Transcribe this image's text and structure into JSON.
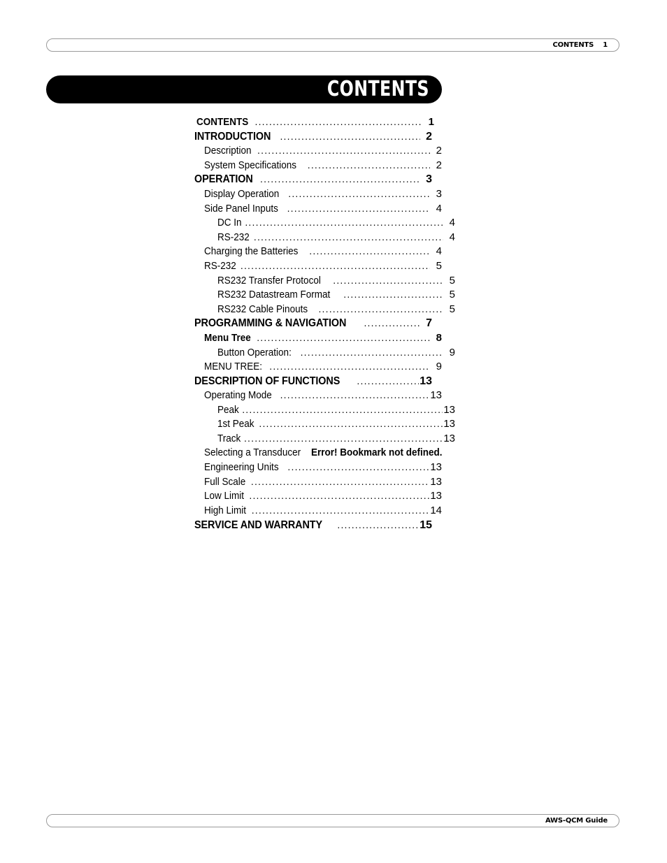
{
  "document": {
    "running_header": "CONTENTS    1",
    "running_footer": "AWS-QCM Guide",
    "title_bar": "CONTENTS"
  },
  "toc": {
    "entries": [
      {
        "title": "CONTENTS",
        "page": "1",
        "level": 1,
        "bold": true,
        "leader": true,
        "extra_indent": true
      },
      {
        "title": "INTRODUCTION",
        "page": "2",
        "level": 1,
        "bold": true,
        "leader": true
      },
      {
        "title": "Description",
        "page": "2",
        "level": 2,
        "bold": false,
        "leader": true
      },
      {
        "title": "System Specifications",
        "page": "2",
        "level": 2,
        "bold": false,
        "leader": true
      },
      {
        "title": "OPERATION",
        "page": "3",
        "level": 1,
        "bold": true,
        "leader": true
      },
      {
        "title": "Display Operation",
        "page": "3",
        "level": 2,
        "bold": false,
        "leader": true
      },
      {
        "title": "Side   Panel Inputs",
        "page": "4",
        "level": 2,
        "bold": false,
        "leader": true
      },
      {
        "title": "DC In",
        "page": "4",
        "level": 3,
        "bold": false,
        "leader": true
      },
      {
        "title": "RS-232",
        "page": "4",
        "level": 3,
        "bold": false,
        "leader": true
      },
      {
        "title": "Charging the Batteries",
        "page": "4",
        "level": 2,
        "bold": false,
        "leader": true
      },
      {
        "title": "RS-232",
        "page": "5",
        "level": 2,
        "bold": false,
        "leader": true
      },
      {
        "title": "RS232 Transfer Protocol",
        "page": "5",
        "level": 3,
        "bold": false,
        "leader": true
      },
      {
        "title": "RS232 Datastream Format",
        "page": "5",
        "level": 3,
        "bold": false,
        "leader": true
      },
      {
        "title": "RS232 Cable Pinouts",
        "page": "5",
        "level": 3,
        "bold": false,
        "leader": true
      },
      {
        "title": "PROGRAMMING & NAVIGATION",
        "page": "7",
        "level": 1,
        "bold": true,
        "leader": true
      },
      {
        "title": "Menu Tree",
        "page": "8",
        "level": 2,
        "bold": true,
        "leader": true
      },
      {
        "title": "Button Operation:",
        "page": "9",
        "level": 3,
        "bold": false,
        "leader": true
      },
      {
        "title": "MENU TREE:",
        "page": "9",
        "level": 2,
        "bold": false,
        "leader": true
      },
      {
        "title": "DESCRIPTION OF FUNCTIONS",
        "page": "13",
        "level": 1,
        "bold": true,
        "leader": true
      },
      {
        "title": "Operating Mode",
        "page": "13",
        "level": 2,
        "bold": false,
        "leader": true
      },
      {
        "title": "Peak",
        "page": "13",
        "level": 3,
        "bold": false,
        "leader": true
      },
      {
        "title": "1st Peak",
        "page": "13",
        "level": 3,
        "bold": false,
        "leader": true
      },
      {
        "title": "Track",
        "page": "13",
        "level": 3,
        "bold": false,
        "leader": true
      },
      {
        "title": "Selecting a Transducer",
        "page": "",
        "level": 2,
        "bold": false,
        "leader": false,
        "error": "Error! Bookmark not defined."
      },
      {
        "title": "Engineering Units",
        "page": "13",
        "level": 2,
        "bold": false,
        "leader": true
      },
      {
        "title": "Full Scale",
        "page": "13",
        "level": 2,
        "bold": false,
        "leader": true
      },
      {
        "title": "Low Limit",
        "page": "13",
        "level": 2,
        "bold": false,
        "leader": true
      },
      {
        "title": "High Limit",
        "page": "14",
        "level": 2,
        "bold": false,
        "leader": true
      },
      {
        "title": "SERVICE AND WARRANTY",
        "page": "15",
        "level": 1,
        "bold": true,
        "leader": true
      }
    ]
  }
}
